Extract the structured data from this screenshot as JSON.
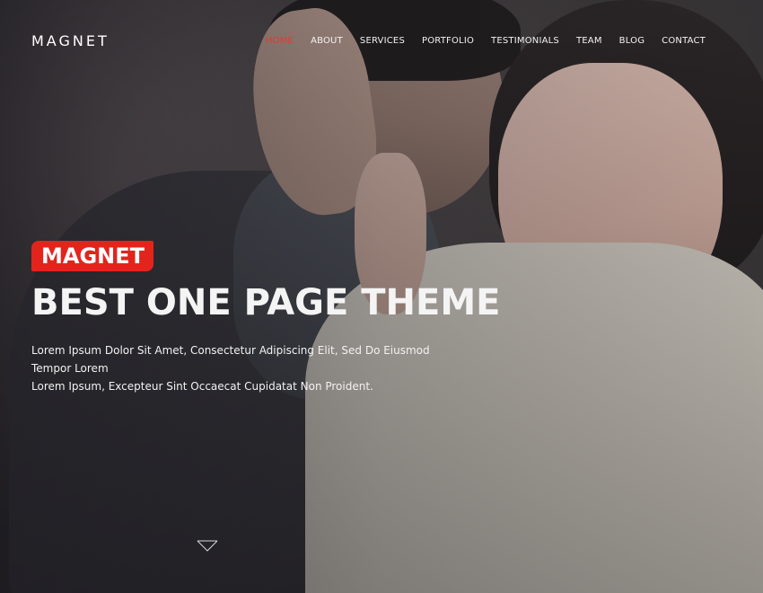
{
  "header": {
    "logo": "MAGNET",
    "nav": [
      {
        "label": "HOME",
        "active": true
      },
      {
        "label": "ABOUT",
        "active": false
      },
      {
        "label": "SERVICES",
        "active": false
      },
      {
        "label": "PORTFOLIO",
        "active": false
      },
      {
        "label": "TESTIMONIALS",
        "active": false
      },
      {
        "label": "TEAM",
        "active": false
      },
      {
        "label": "BLOG",
        "active": false
      },
      {
        "label": "CONTACT",
        "active": false
      }
    ]
  },
  "hero": {
    "badge": "MAGNET",
    "headline": "BEST ONE PAGE THEME",
    "lede_line1": "Lorem Ipsum Dolor Sit Amet, Consectetur Adipiscing Elit, Sed Do Eiusmod Tempor Lorem",
    "lede_line2": "Lorem Ipsum, Excepteur Sint Occaecat Cupidatat Non Proident.",
    "scroll_icon": "chevron-down-icon"
  },
  "colors": {
    "accent": "#e3241d",
    "active_nav": "#e8392f",
    "text": "#ffffff"
  }
}
